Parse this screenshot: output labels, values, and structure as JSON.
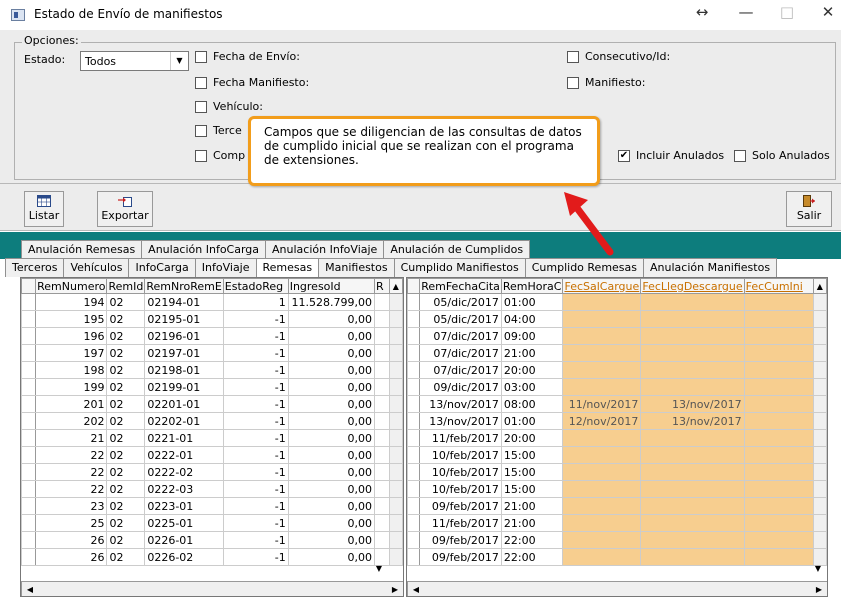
{
  "window": {
    "title": "Estado de Envío de manifiestos",
    "restore_glyph": "↔",
    "minimize_glyph": "—",
    "maximize_glyph": "□",
    "close_glyph": "✕"
  },
  "options": {
    "legend": "Opciones:",
    "estado_label": "Estado:",
    "estado_value": "Todos",
    "checks_left": [
      {
        "label": "Fecha de Envío:",
        "checked": false
      },
      {
        "label": "Fecha Manifiesto:",
        "checked": false
      },
      {
        "label": "Vehículo:",
        "checked": false
      },
      {
        "label": "Terce",
        "checked": false
      },
      {
        "label": "Comp",
        "checked": false
      }
    ],
    "checks_right": [
      {
        "label": "Consecutivo/Id:",
        "checked": false
      },
      {
        "label": "Manifiesto:",
        "checked": false
      }
    ],
    "incluir_anulados": {
      "label": "Incluir Anulados",
      "checked": true
    },
    "solo_anulados": {
      "label": "Solo Anulados",
      "checked": false
    }
  },
  "toolbar": {
    "listar_label": "Listar",
    "exportar_label": "Exportar",
    "salir_label": "Salir"
  },
  "tabs_top": [
    "Anulación Remesas",
    "Anulación InfoCarga",
    "Anulación InfoViaje",
    "Anulación de Cumplidos"
  ],
  "tabs_bottom": [
    "Terceros",
    "Vehículos",
    "InfoCarga",
    "InfoViaje",
    "Remesas",
    "Manifiestos",
    "Cumplido Manifiestos",
    "Cumplido Remesas",
    "Anulación Manifiestos"
  ],
  "active_tab": "Remesas",
  "left_grid": {
    "columns": [
      "RemNumero",
      "RemId",
      "RemNroRemE",
      "EstadoReg",
      "IngresoId",
      "R"
    ],
    "rows": [
      [
        "194",
        "02",
        "02194-01",
        "1",
        "11.528.799,00"
      ],
      [
        "195",
        "02",
        "02195-01",
        "-1",
        "0,00"
      ],
      [
        "196",
        "02",
        "02196-01",
        "-1",
        "0,00"
      ],
      [
        "197",
        "02",
        "02197-01",
        "-1",
        "0,00"
      ],
      [
        "198",
        "02",
        "02198-01",
        "-1",
        "0,00"
      ],
      [
        "199",
        "02",
        "02199-01",
        "-1",
        "0,00"
      ],
      [
        "201",
        "02",
        "02201-01",
        "-1",
        "0,00"
      ],
      [
        "202",
        "02",
        "02202-01",
        "-1",
        "0,00"
      ],
      [
        "21",
        "02",
        "0221-01",
        "-1",
        "0,00"
      ],
      [
        "22",
        "02",
        "0222-01",
        "-1",
        "0,00"
      ],
      [
        "22",
        "02",
        "0222-02",
        "-1",
        "0,00"
      ],
      [
        "22",
        "02",
        "0222-03",
        "-1",
        "0,00"
      ],
      [
        "23",
        "02",
        "0223-01",
        "-1",
        "0,00"
      ],
      [
        "25",
        "02",
        "0225-01",
        "-1",
        "0,00"
      ],
      [
        "26",
        "02",
        "0226-01",
        "-1",
        "0,00"
      ],
      [
        "26",
        "02",
        "0226-02",
        "-1",
        "0,00"
      ]
    ]
  },
  "right_grid": {
    "columns": [
      "RemFechaCita",
      "RemHoraC",
      "FecSalCargue",
      "FecLlegDescargue",
      "FecCumIni"
    ],
    "rows": [
      [
        "05/dic/2017",
        "01:00",
        "",
        ""
      ],
      [
        "05/dic/2017",
        "04:00",
        "",
        ""
      ],
      [
        "07/dic/2017",
        "09:00",
        "",
        ""
      ],
      [
        "07/dic/2017",
        "21:00",
        "",
        ""
      ],
      [
        "07/dic/2017",
        "20:00",
        "",
        ""
      ],
      [
        "09/dic/2017",
        "03:00",
        "",
        ""
      ],
      [
        "13/nov/2017",
        "08:00",
        "11/nov/2017",
        "13/nov/2017"
      ],
      [
        "13/nov/2017",
        "01:00",
        "12/nov/2017",
        "13/nov/2017"
      ],
      [
        "11/feb/2017",
        "20:00",
        "",
        ""
      ],
      [
        "10/feb/2017",
        "15:00",
        "",
        ""
      ],
      [
        "10/feb/2017",
        "15:00",
        "",
        ""
      ],
      [
        "10/feb/2017",
        "15:00",
        "",
        ""
      ],
      [
        "09/feb/2017",
        "21:00",
        "",
        ""
      ],
      [
        "11/feb/2017",
        "21:00",
        "",
        ""
      ],
      [
        "09/feb/2017",
        "22:00",
        "",
        ""
      ],
      [
        "09/feb/2017",
        "22:00",
        "",
        ""
      ]
    ]
  },
  "callout_text": "Campos que se diligencian de las consultas de datos de cumplido inicial que se realizan con el programa de extensiones.",
  "colors": {
    "highlight": "#f7ce8f",
    "callout_border": "#f29d1b",
    "arrow": "#e21b1b",
    "teal": "#0d7d7d"
  }
}
